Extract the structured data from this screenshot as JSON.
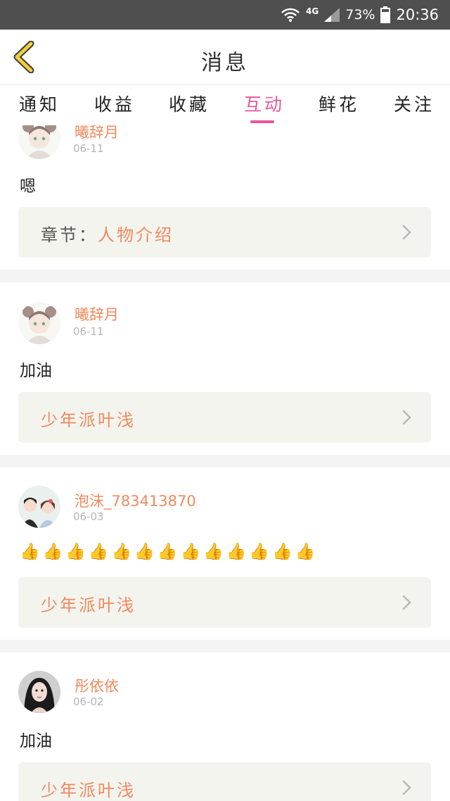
{
  "status_bar": {
    "network": "4G",
    "battery": "73%",
    "time": "20:36"
  },
  "header": {
    "title": "消息"
  },
  "tabs": [
    {
      "label": "通知",
      "active": false
    },
    {
      "label": "收益",
      "active": false
    },
    {
      "label": "收藏",
      "active": false
    },
    {
      "label": "互动",
      "active": true
    },
    {
      "label": "鲜花",
      "active": false
    },
    {
      "label": "关注",
      "active": false
    }
  ],
  "messages": [
    {
      "user": "曦辞月",
      "date": "06-11",
      "text": "嗯",
      "ref_prefix": "章节：",
      "ref_name": "人物介绍",
      "avatar": "raccoon-girl"
    },
    {
      "user": "曦辞月",
      "date": "06-11",
      "text": "加油",
      "ref_prefix": "",
      "ref_name": "少年派叶浅",
      "avatar": "raccoon-girl"
    },
    {
      "user": "泡沫_783413870",
      "date": "06-03",
      "text": "",
      "thumbs_count": 13,
      "ref_prefix": "",
      "ref_name": "少年派叶浅",
      "avatar": "couple"
    },
    {
      "user": "彤依依",
      "date": "06-02",
      "text": "加油",
      "ref_prefix": "",
      "ref_name": "少年派叶浅",
      "avatar": "portrait"
    }
  ],
  "colors": {
    "accent": "#e6579a",
    "username": "#f08a5d",
    "back_arrow": "#f2cf3a",
    "status_bar": "#4f4f4f"
  }
}
